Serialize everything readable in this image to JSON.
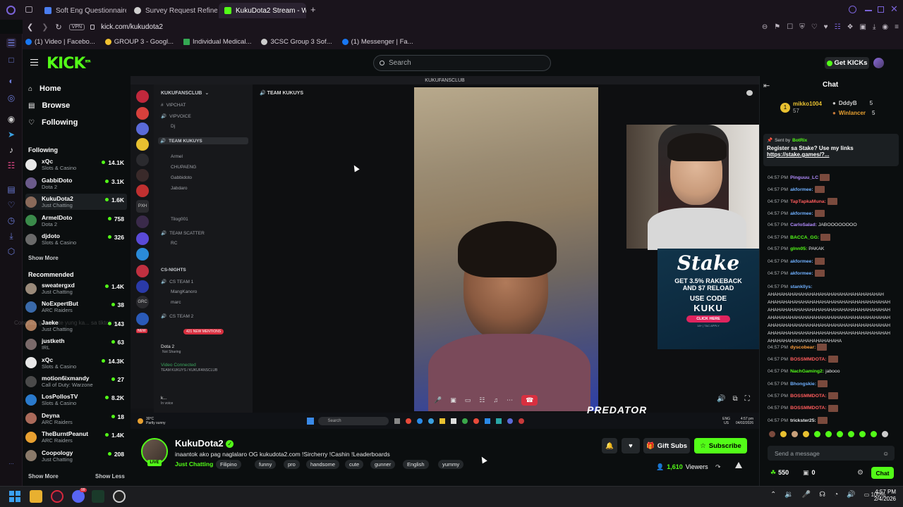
{
  "browser": {
    "tabs": [
      {
        "label": "Soft Eng Questionnaire - G"
      },
      {
        "label": "Survey Request Refineme"
      },
      {
        "label": "KukuDota2 Stream - W"
      }
    ],
    "vpn": "VPN",
    "url": "kick.com/kukudota2",
    "bookmarks": [
      "(1) Video | Facebo...",
      "GROUP 3 - Googl...",
      "Individual Medical...",
      "3CSC Group 3 Sof...",
      "(1) Messenger | Fa..."
    ]
  },
  "header": {
    "logo": "KICK",
    "logo_tag": "BETA",
    "search_placeholder": "Search",
    "get_kicks": "Get KICKs"
  },
  "nav": {
    "home": "Home",
    "browse": "Browse",
    "following": "Following",
    "following_title": "Following",
    "recommended_title": "Recommended",
    "show_more": "Show More",
    "show_less": "Show Less",
    "following_channels": [
      {
        "name": "xQc",
        "category": "Slots & Casino",
        "viewers": "14.1K",
        "color": "#e8e8e8"
      },
      {
        "name": "GabbiDoto",
        "category": "Dota 2",
        "viewers": "3.1K",
        "color": "#6a5a8a"
      },
      {
        "name": "KukuDota2",
        "category": "Just Chatting",
        "viewers": "1.6K",
        "color": "#8a6a5a"
      },
      {
        "name": "ArmelDoto",
        "category": "Dota 2",
        "viewers": "758",
        "color": "#3a8a4a"
      },
      {
        "name": "djdoto",
        "category": "Slots & Casino",
        "viewers": "326",
        "color": "#6a6a6a"
      }
    ],
    "recommended_channels": [
      {
        "name": "sweatergxd",
        "category": "Just Chatting",
        "viewers": "1.4K",
        "color": "#9a8a7a"
      },
      {
        "name": "NoExpertBut",
        "category": "ARC Raiders",
        "viewers": "38",
        "color": "#3a6aaa"
      },
      {
        "name": "Jaeke",
        "category": "Just Chatting",
        "viewers": "143",
        "color": "#aa7a5a"
      },
      {
        "name": "justketh",
        "category": "IRL",
        "viewers": "63",
        "color": "#7a6a6a"
      },
      {
        "name": "xQc",
        "category": "Slots & Casino",
        "viewers": "14.3K",
        "color": "#e8e8e8"
      },
      {
        "name": "motion6ixmandy",
        "category": "Call of Duty: Warzone",
        "viewers": "27",
        "color": "#4a4a4a"
      },
      {
        "name": "LosPollosTV",
        "category": "Slots & Casino",
        "viewers": "8.2K",
        "color": "#2a7acc"
      },
      {
        "name": "Deyna",
        "category": "ARC Raiders",
        "viewers": "18",
        "color": "#aa6a5a"
      },
      {
        "name": "TheBurntPeanut",
        "category": "ARC Raiders",
        "viewers": "1.4K",
        "color": "#e8a030"
      },
      {
        "name": "Coopology",
        "category": "Just Chatting",
        "viewers": "208",
        "color": "#8a7a6a"
      }
    ]
  },
  "video": {
    "discord_title": "KUKUFANSCLUB",
    "server_name": "KUKUFANSCLUB",
    "channel_header": "TEAM KUKUYS",
    "channels": [
      "VIPCHAT",
      "VIPVOICE",
      "Dj",
      "TEAM KUKUYS",
      "Armel",
      "CHUPAENG",
      "Gabbidoto",
      "Jabdaro",
      "Tilog001",
      "TEAM SCATTER",
      "RC",
      "CS-NIGHTS",
      "CS TEAM 1",
      "MangKanoro",
      "marc",
      "CS TEAM 2"
    ],
    "dota_status": "Dota 2",
    "not_sharing": "Not Sharing",
    "video_connected": "Video Connected",
    "voice_channel": "TEAM KUKUYS / KUKUFANSCLUB",
    "mentions": "421 NEW MENTIONS",
    "new_badge": "NEW",
    "user_short": "k...",
    "user_status": "In voice",
    "weather_temp": "30°C",
    "weather_desc": "Partly sunny",
    "taskbar_search": "Search",
    "lang": "ENG",
    "region": "US",
    "in_time": "4:57 pm",
    "in_date": "04/02/2026",
    "brand": "PREDATOR",
    "overlay_text": "Congrats ga minute yung ka... sa tiktok ng",
    "stake": {
      "logo": "Stake",
      "line1": "GET 3.5% RAKEBACK",
      "line2": "AND $7 RELOAD",
      "code_label": "USE CODE",
      "code": "KUKU",
      "cta": "CLICK HERE",
      "fine": "18+ | T&C APPLY"
    }
  },
  "stream": {
    "name": "KukuDota2",
    "live": "LIVE",
    "title": "inaantok ako pag naglalaro OG kukudota2.com !Sircherry !Cashin !Leaderboards",
    "category": "Just Chatting",
    "tags": [
      "Filipino",
      "funny",
      "pro",
      "handsome",
      "cute",
      "gunner",
      "English",
      "yummy"
    ],
    "gift_subs": "Gift Subs",
    "subscribe": "Subscribe",
    "viewers": "1,610",
    "viewers_label": "Viewers"
  },
  "chat": {
    "title": "Chat",
    "top_gifter": {
      "name": "mikko1004",
      "count": "57"
    },
    "top_others": [
      {
        "name": "DddyB",
        "count": "5"
      },
      {
        "name": "Winlancer",
        "count": "5"
      }
    ],
    "pinned_sender_prefix": "Sent by",
    "pinned_sender": "BotRix",
    "pinned_text": "Register sa Stake? Use my links",
    "pinned_link": "https://stake.games/?...",
    "messages": [
      {
        "time": "04:57 PM",
        "user": "Pinguuu_LC",
        "text": "",
        "color": "#b38cff",
        "emote": true
      },
      {
        "time": "04:57 PM",
        "user": "akformee:",
        "text": "",
        "color": "#6fb0ff",
        "emote": true
      },
      {
        "time": "04:57 PM",
        "user": "TapTapkaMuna:",
        "text": "",
        "color": "#ff5c5c",
        "emote": true
      },
      {
        "time": "04:57 PM",
        "user": "akformee:",
        "text": "",
        "color": "#6fb0ff",
        "emote": true
      },
      {
        "time": "04:57 PM",
        "user": "CarloSalad:",
        "text": "JABOOOOOOOO",
        "color": "#b38cff",
        "emote": false
      },
      {
        "time": "04:57 PM",
        "user": "BACCA_GG:",
        "text": "",
        "color": "#53fc18",
        "emote": true
      },
      {
        "time": "04:57 PM",
        "user": "glnn05:",
        "text": "PAKAK",
        "color": "#53fc18",
        "emote": false
      },
      {
        "time": "04:57 PM",
        "user": "akformee:",
        "text": "",
        "color": "#6fb0ff",
        "emote": true
      },
      {
        "time": "04:57 PM",
        "user": "akformee:",
        "text": "",
        "color": "#6fb0ff",
        "emote": true
      }
    ],
    "laugh_user": "stankllys:",
    "laugh_time": "04:57 PM",
    "laugh_lines": [
      "AHAHAHAHAHAHAHAHAHAHAHAHAHAHAHAHAHAH",
      "AHAHAHAHAHAHAHAHAHAHAHAHAHAHAHAHAHAHAH",
      "AHAHAHAHAHAHAHAHAHAHAHAHAHAHAHAHAHAHAH",
      "AHAHAHAHAHAHAHAHAHAHAHAHAHAHAHAHAHAHAH",
      "AHAHAHAHAHAHAHAHAHAHAHAHAHAHAHAHAHAHAH",
      "AHAHAHAHAHAHAHAHAHAHAHAHAHAHAHAHAHAHAH",
      "AHAHAHAHAHAHAHAHAHAHAHA"
    ],
    "messages2": [
      {
        "time": "04:57 PM",
        "user": "dyscobear:",
        "text": "",
        "color": "#ff9d3c",
        "emote": true
      },
      {
        "time": "04:57 PM",
        "user": "BOSSMMDOTA:",
        "text": "",
        "color": "#ff5c5c",
        "emote": true
      },
      {
        "time": "04:57 PM",
        "user": "NachGaming2:",
        "text": "jabooo",
        "color": "#53fc18",
        "emote": false
      },
      {
        "time": "04:57 PM",
        "user": "Bhongskie:",
        "text": "",
        "color": "#6fb0ff",
        "emote": true
      },
      {
        "time": "04:57 PM",
        "user": "BOSSMMDOTA:",
        "text": "",
        "color": "#ff5c5c",
        "emote": true
      },
      {
        "time": "04:57 PM",
        "user": "BOSSMMDOTA:",
        "text": "",
        "color": "#ff5c5c",
        "emote": true
      },
      {
        "time": "04:57 PM",
        "user": "trickster25:",
        "text": "",
        "color": "#e6e7e8",
        "emote": true
      }
    ],
    "input_placeholder": "Send a message",
    "points": "550",
    "other_count": "0",
    "chat_button": "Chat"
  },
  "os": {
    "time": "4:57 PM",
    "date": "2/4/2026",
    "battery": "100%",
    "badge": "99"
  },
  "colors": {
    "accent": "#53fc18",
    "bg": "#0b0e0f"
  }
}
